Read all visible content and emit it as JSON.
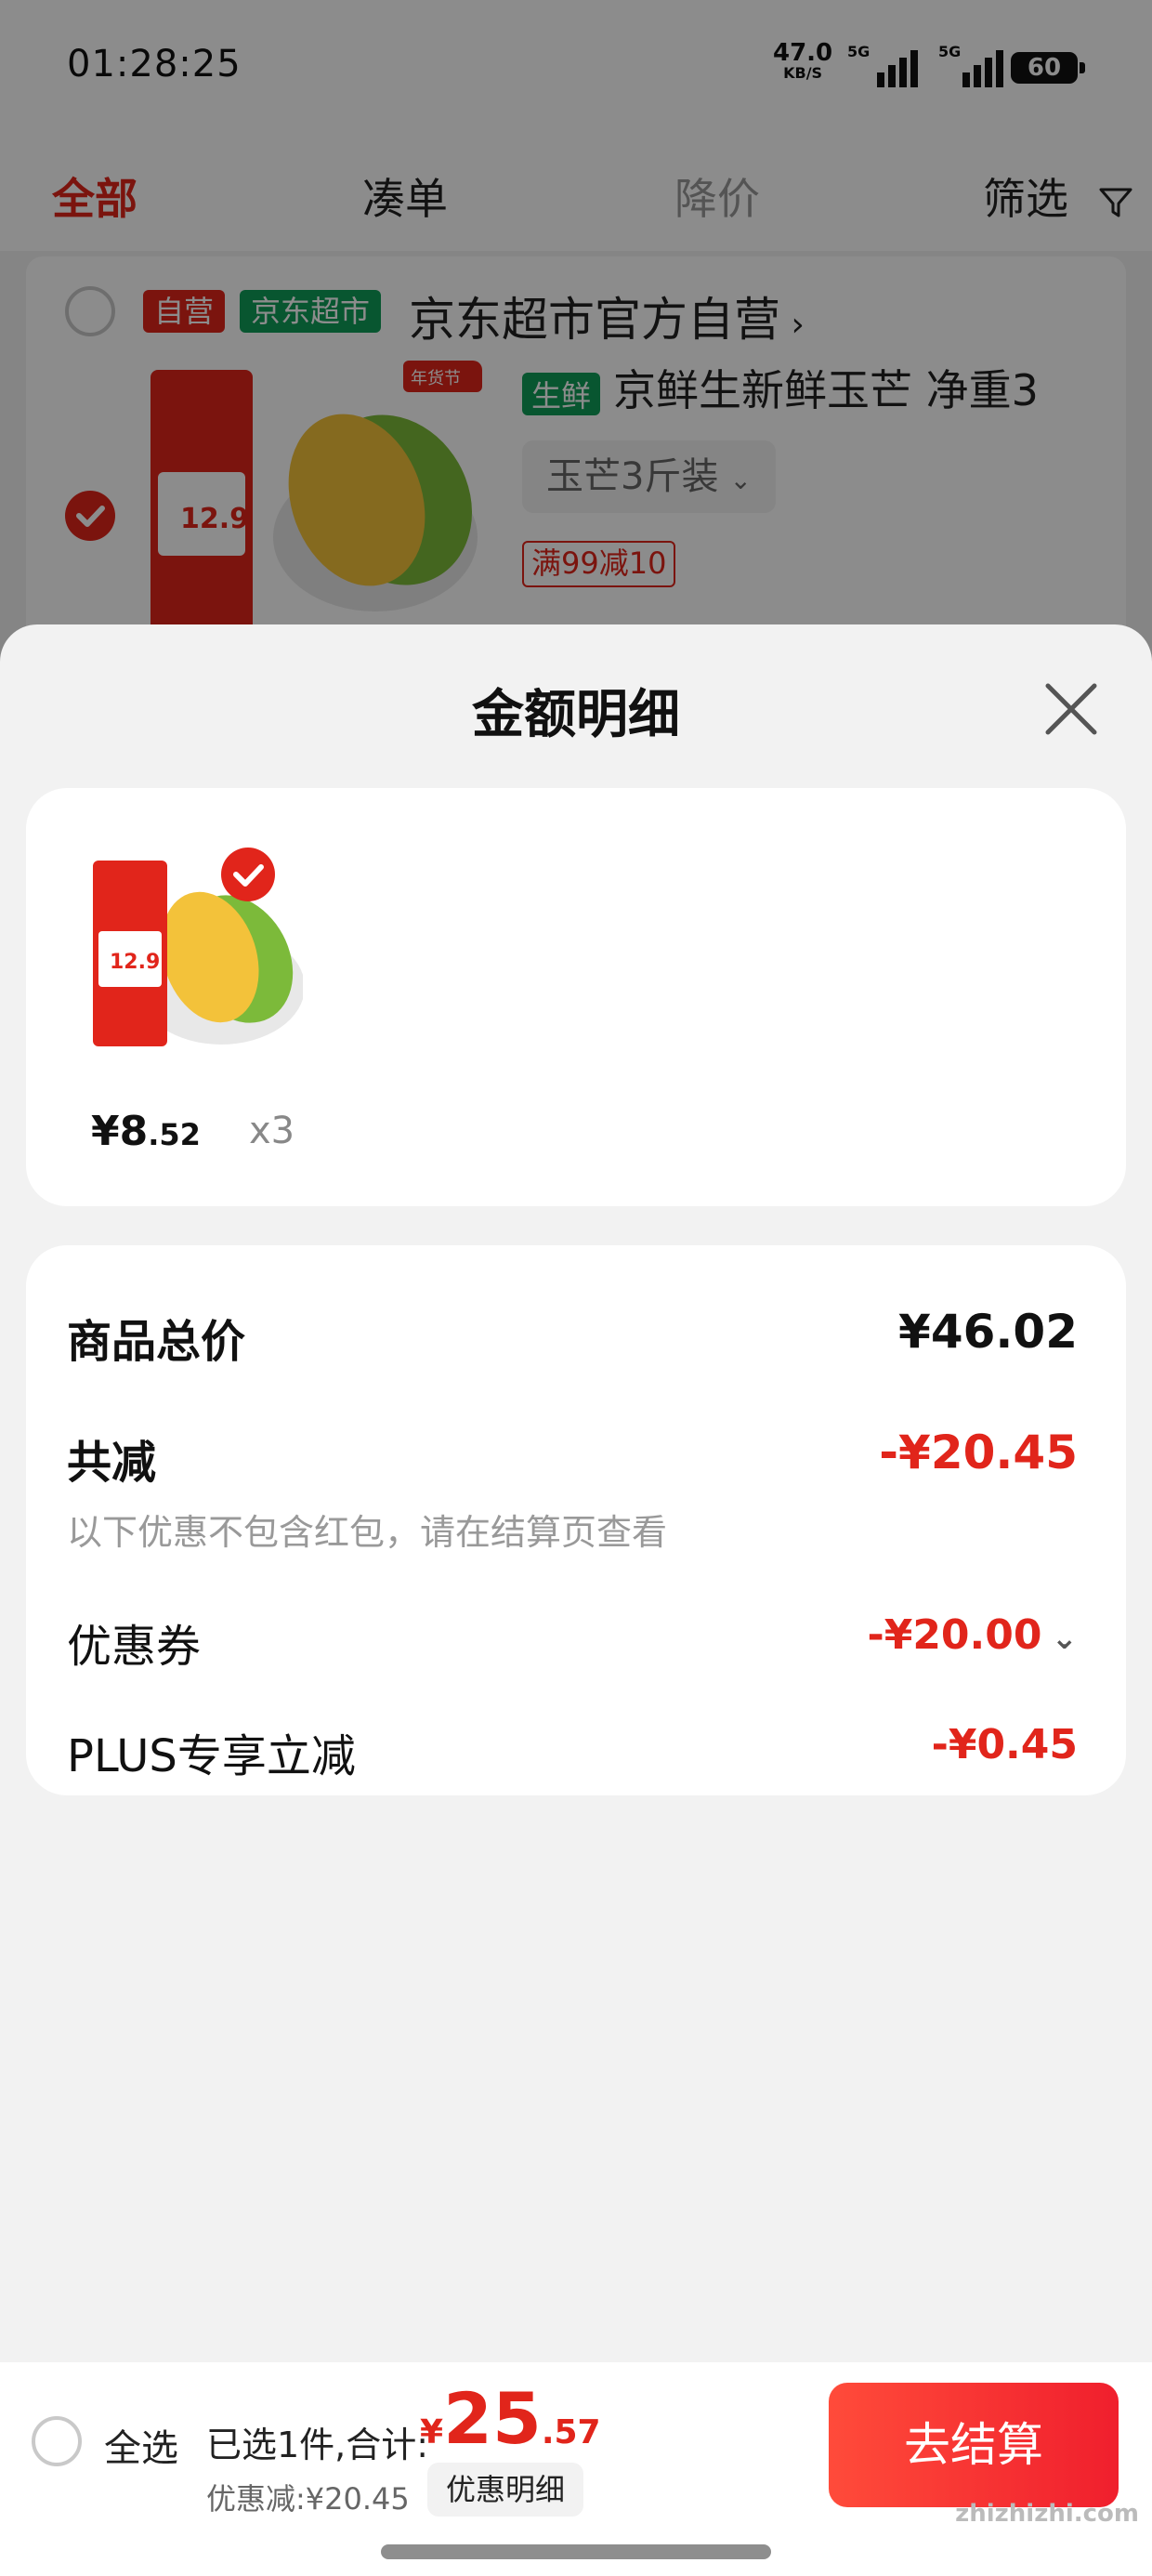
{
  "status_bar": {
    "time": "01:28:25",
    "net_speed": "47.0",
    "net_unit": "KB/S",
    "signal1_label": "5G",
    "signal2_label": "5G",
    "battery": "60"
  },
  "tabs": [
    {
      "label": "全部",
      "active": true
    },
    {
      "label": "凑单",
      "active": false
    },
    {
      "label": "降价",
      "active": false
    },
    {
      "label": "筛选",
      "active": false
    }
  ],
  "shop": {
    "tag_self": "自营",
    "tag_market": "京东超市",
    "name": "京东超市官方自营",
    "product_tag": "生鲜",
    "product_title": "京鲜生新鲜玉芒 净重3",
    "spec": "玉芒3斤装",
    "promo": "满99减10",
    "img_badge": "年货节",
    "img_price": "12.9"
  },
  "sheet": {
    "title": "金额明细",
    "item": {
      "price_int": "¥8",
      "price_dec": ".52",
      "qty": "x3",
      "img_price": "12.9"
    },
    "summary": {
      "goods_total_label": "商品总价",
      "goods_total_value": "¥46.02",
      "total_off_label": "共减",
      "total_off_value": "-¥20.45",
      "note": "以下优惠不包含红包，请在结算页查看",
      "coupon_label": "优惠券",
      "coupon_value": "-¥20.00",
      "plus_label": "PLUS专享立减",
      "plus_value": "-¥0.45"
    }
  },
  "checkout": {
    "select_all": "全选",
    "selected_text": "已选1件,合计:",
    "total_cur": "¥",
    "total_int": "25",
    "total_dec": ".57",
    "discount_text": "优惠减:¥20.45",
    "detail_btn": "优惠明细",
    "checkout_btn": "去结算"
  },
  "watermark": "zhizhizhi.com",
  "colors": {
    "accent": "#e1251b",
    "market_green": "#0f9d58"
  }
}
